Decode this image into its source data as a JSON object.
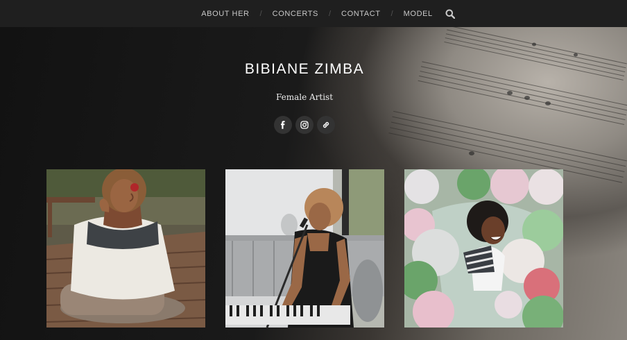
{
  "nav": {
    "items": [
      {
        "label": "ABOUT HER"
      },
      {
        "label": "CONCERTS"
      },
      {
        "label": "CONTACT"
      },
      {
        "label": "MODEL"
      }
    ],
    "separator": "/",
    "search_icon": "search-icon"
  },
  "header": {
    "title": "BIBIANE ZIMBA",
    "tagline": "Female Artist"
  },
  "social": [
    {
      "icon": "facebook-icon"
    },
    {
      "icon": "instagram-icon"
    },
    {
      "icon": "link-icon"
    }
  ],
  "gallery": {
    "items": [
      {
        "subject": "woman-in-nordic-sweater-on-deck"
      },
      {
        "subject": "woman-singing-at-keyboard"
      },
      {
        "subject": "woman-lying-among-balloons"
      }
    ]
  },
  "colors": {
    "topbar": "#1f1f1f",
    "nav_text": "#c9c9c9",
    "title_text": "#ffffff",
    "social_bg": "#333333"
  }
}
